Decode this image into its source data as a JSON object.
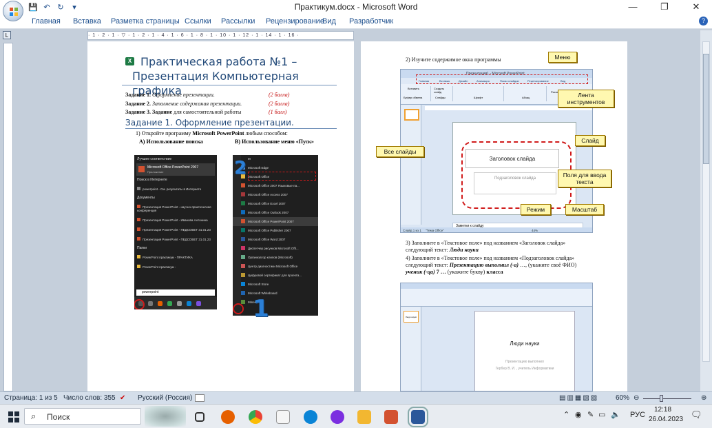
{
  "window": {
    "title": "Практикум.docx - Microsoft Word",
    "minimize": "—",
    "maximize": "❐",
    "close": "✕"
  },
  "qat": {
    "save": "💾",
    "undo": "↶",
    "redo": "↻",
    "more": "▾"
  },
  "ribbon": {
    "tabs": [
      "Главная",
      "Вставка",
      "Разметка страницы",
      "Ссылки",
      "Рассылки",
      "Рецензирование",
      "Вид",
      "Разработчик"
    ],
    "help": "?"
  },
  "ruler": {
    "corner": "L",
    "scale": "· 1 · 2 · 1 · ▽ · 1 · 2 · 1 · 4 · 1 · 6 · 1 · 8 · 1 · 10 · 1 · 12 · 1 · 14 · 1 · 16 ·"
  },
  "page1": {
    "title_line1": "Практическая работа №1 –",
    "title_line2": "Презентация Компьютерная графика",
    "tasks": [
      {
        "label": "Задание 1.",
        "text": "Оформление презентации.",
        "points": "(2 балла)"
      },
      {
        "label": "Задание 2.",
        "text": "Заполнение содержания презентации.",
        "points": "(2 балла)"
      },
      {
        "label": "Задание 3. Задание",
        "text": "для самостоятельной работы",
        "points": "(1 балл)"
      }
    ],
    "section_title": "Задание 1. Оформление презентации.",
    "step1_prefix": "1) Откройте программу",
    "step1_app": "Microsoft PowerPoint",
    "step1_suffix": "любым способом:",
    "method_a": "А) Использование поиска",
    "method_b": "В) Использование меню «Пуск»",
    "shotA": {
      "header": "Лучшее соответствие",
      "best_title": "Microsoft Office PowerPoint 2007",
      "best_sub": "Приложение",
      "web_header": "Поиск в Интернете",
      "web_item": "powerpoint - См. результаты в Интернете",
      "docs_header": "Документы",
      "docs": [
        "Презентация PowerPoint - научно-практическая конференция",
        "Презентация PowerPoint - Иванова Антонина",
        "Презентация PowerPoint - ПЕДСОВЕТ 31.01.23",
        "Презентация PowerPoint - ПЕДСОВЕТ 31.01.23"
      ],
      "folders_header": "Папки",
      "folders": [
        "PowerPoint практикум - ПРАКТИКА",
        "PowerPoint практикум -"
      ],
      "search_text": "powerpoint"
    },
    "shotB": {
      "letter": "M",
      "items": [
        "Microsoft Edge",
        "Microsoft Office",
        "Microsoft Office 2007 Языковые па...",
        "Microsoft Office Access 2007",
        "Microsoft Office Excel 2007",
        "Microsoft Office Outlook 2007",
        "Microsoft Office PowerPoint 2007",
        "Microsoft Office Publisher 2007",
        "Microsoft Office Word 2007",
        "Диспетчер рисунков Microsoft Offi...",
        "Организатор клипов (Microsoft)",
        "Центр диагностики Microsoft Office",
        "Цифровой сертификат для проекта...",
        "Microsoft Store",
        "Microsoft Whiteboard",
        "Minecraft"
      ],
      "num1": "1",
      "num2": "2"
    }
  },
  "page2": {
    "step2": "2) Изучите содержимое окна программы",
    "pp": {
      "title": "Презентация1 - Microsoft PowerPoint",
      "tabs": [
        "Главная",
        "Вставка",
        "Дизайн",
        "Анимация",
        "Показ слайдов",
        "Рецензирование",
        "Вид"
      ],
      "groups": [
        "Вставить",
        "Создать слайд",
        "Буфер обмена",
        "Слайды",
        "Шрифт",
        "Абзац",
        "Рисование"
      ],
      "title_ph": "Заголовок слайда",
      "subtitle_ph": "Подзаголовок слайда",
      "notes": "Заметки к слайду",
      "status_left": "Слайд 1 из 1",
      "status_theme": "\"Тема Office\"",
      "zoom": "44%"
    },
    "callouts": {
      "menu": "Меню",
      "ribbon": "Лента инструментов",
      "all_slides": "Все слайды",
      "slide": "Слайд",
      "fields": "Поля для ввода текста",
      "mode": "Режим",
      "zoom": "Масштаб"
    },
    "step3_a": "3) Заполните в «Текстовое поле» под названием «Заголовок слайда»",
    "step3_b": "следующий текст:",
    "step3_val": "Люди науки",
    "step4_a": "4) Заполните в «Текстовое поле» под названием «Подзаголовок слайда»",
    "step4_b": "следующий текст:",
    "step4_val": "Презентацию выполнил (-а)",
    "step4_c": "…, (укажите своё ФИО)",
    "step4_d": "ученик (-ца)",
    "step4_e": "7 …",
    "step4_f": "(укажите букву)",
    "step4_g": "класса",
    "pp2": {
      "title": "Люди науки",
      "sub1": "Презентацию выполнил",
      "sub2": "Гербер В. И. , учитель Информатики",
      "thumb": "Люди науки"
    }
  },
  "status": {
    "page": "Страница: 1 из 5",
    "words": "Число слов: 355",
    "lang": "Русский (Россия)",
    "zoom": "60%"
  },
  "taskbar": {
    "search": "Поиск",
    "lang": "РУС",
    "time": "12:18",
    "date": "26.04.2023"
  }
}
